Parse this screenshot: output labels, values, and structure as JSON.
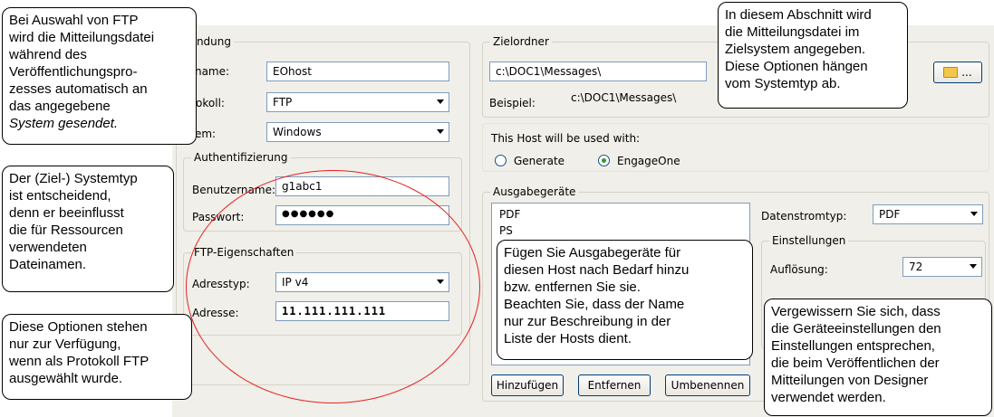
{
  "connection": {
    "group_title": "bindung",
    "hostname_label": "stname:",
    "hostname_value": "EOhost",
    "protocol_label": "otokoll:",
    "protocol_value": "FTP",
    "system_label": "stem:",
    "system_value": "Windows"
  },
  "auth": {
    "group_title": "Authentifizierung",
    "username_label": "Benutzername:",
    "username_value": "g1abc1",
    "password_label": "Passwort:",
    "password_value": "●●●●●●"
  },
  "ftp": {
    "group_title": "FTP-Eigenschaften",
    "address_type_label": "Adresstyp:",
    "address_type_value": "IP v4",
    "address_label": "Adresse:",
    "address_value": "11.111.111.111"
  },
  "target": {
    "group_title": "Zielordner",
    "folder_value": "c:\\DOC1\\Messages\\",
    "example_label": "Beispiel:",
    "example_value": "c:\\DOC1\\Messages\\",
    "browse_label": "..."
  },
  "usage": {
    "label": "This Host will be used with:",
    "option_generate": "Generate",
    "option_engageone": "EngageOne"
  },
  "devices": {
    "group_title": "Ausgabegeräte",
    "items": [
      "PDF",
      "PS"
    ],
    "add_button": "Hinzufügen",
    "remove_button": "Entfernen",
    "rename_button": "Umbenennen",
    "stream_type_label": "Datenstromtyp:",
    "stream_type_value": "PDF",
    "settings_title": "Einstellungen",
    "resolution_label": "Auflösung:",
    "resolution_value": "72"
  },
  "callouts": {
    "ftp": [
      "Bei Auswahl von FTP",
      "wird die Mitteilungsdatei",
      "während des",
      "Veröffentlichungspro-",
      "zesses automatisch an",
      "das angegebene",
      "System gesendet."
    ],
    "system": [
      "Der (Ziel-) Systemtyp",
      "ist entscheidend,",
      "denn er beeinflusst",
      "die für Ressourcen",
      "verwendeten",
      "Dateinamen."
    ],
    "protocol": [
      "Diese Optionen stehen",
      "nur zur Verfügung,",
      "wenn als Protokoll FTP",
      "ausgewählt wurde."
    ],
    "target": [
      "In diesem Abschnitt wird",
      "die Mitteilungsdatei im",
      "Zielsystem angegeben.",
      "Diese Optionen hängen",
      "vom Systemtyp ab."
    ],
    "devices": [
      "Fügen Sie Ausgabegeräte für",
      "diesen Host nach Bedarf hinzu",
      "bzw. entfernen Sie sie.",
      "Beachten Sie, dass der Name",
      "nur zur Beschreibung in der",
      "Liste der Hosts dient."
    ],
    "settings": [
      "Vergewissern Sie sich, dass",
      "die Geräteeinstellungen den",
      "Einstellungen entsprechen,",
      "die beim Veröffentlichen der",
      "Mitteilungen von Designer",
      "verwendet werden."
    ]
  },
  "colors": {
    "dialog_bg": "#f0efe9",
    "highlight_ellipse": "#e52020"
  }
}
